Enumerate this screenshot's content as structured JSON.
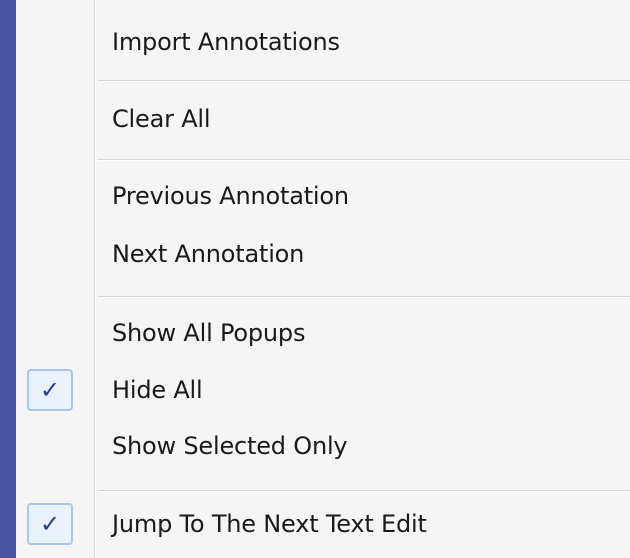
{
  "menu": {
    "items": [
      {
        "label": "Import Annotations",
        "checked": false
      },
      {
        "label": "Clear All",
        "checked": false
      },
      {
        "label": "Previous Annotation",
        "checked": false
      },
      {
        "label": "Next Annotation",
        "checked": false
      },
      {
        "label": "Show All Popups",
        "checked": false
      },
      {
        "label": "Hide All",
        "checked": true
      },
      {
        "label": "Show Selected Only",
        "checked": false
      },
      {
        "label": "Jump To The Next Text Edit",
        "checked": true
      }
    ],
    "check_glyph": "✓"
  },
  "colors": {
    "background": "#4a52a3",
    "menu_bg": "#f5f5f5",
    "check_box_border": "#a9c6e8",
    "check_box_fill": "#e8f1fc"
  }
}
